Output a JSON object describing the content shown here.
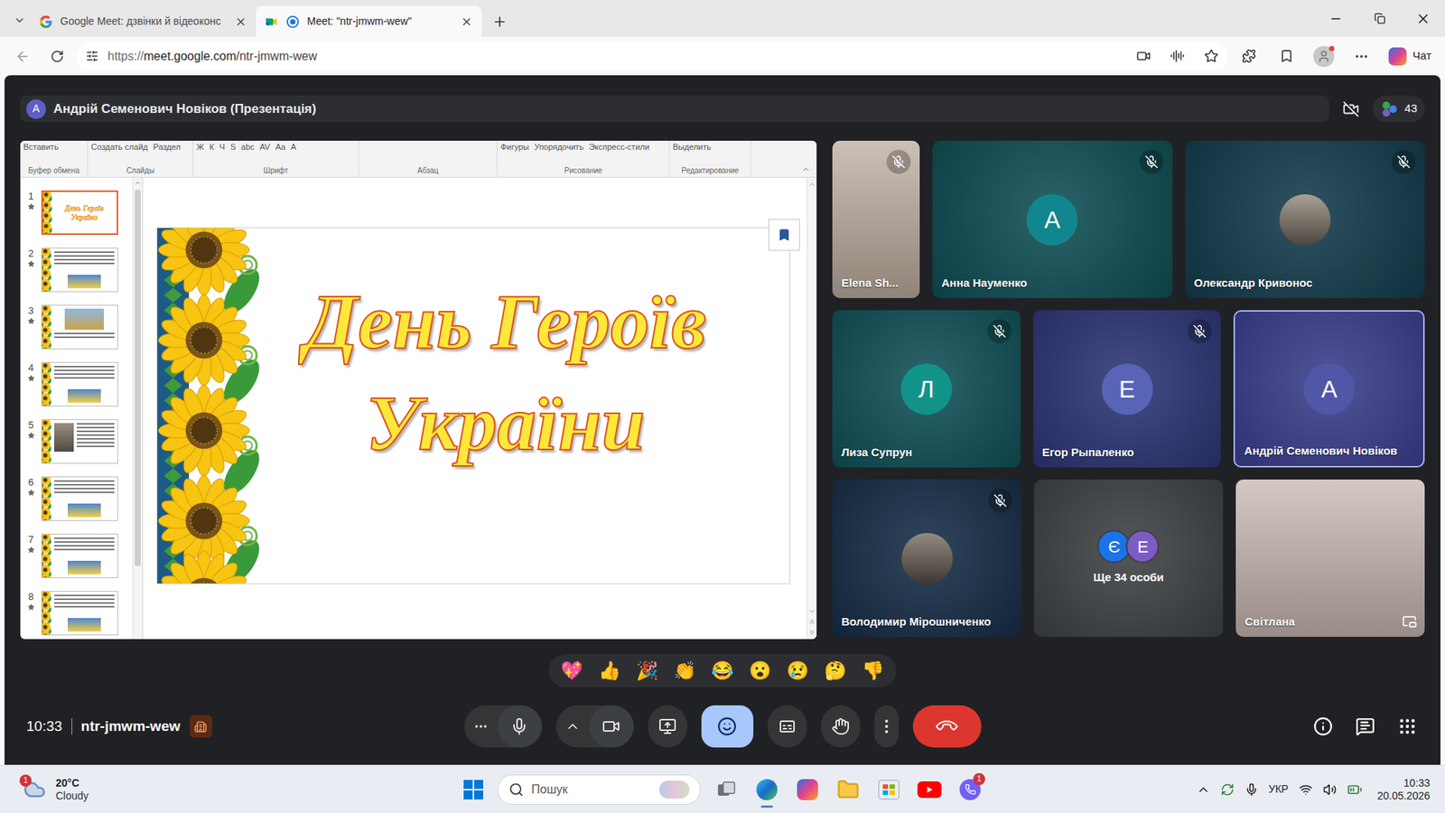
{
  "browser": {
    "tabs": [
      {
        "title": "Google Meet: дзвінки й відеоконс",
        "selected": false,
        "recording": false
      },
      {
        "title": "Meet: \"ntr-jmwm-wew\"",
        "selected": true,
        "recording": true
      }
    ],
    "url": {
      "scheme": "https://",
      "host": "meet.google.com",
      "path": "/ntr-jmwm-wew"
    },
    "copilot_label": "Чат"
  },
  "meet": {
    "presenter": {
      "initial": "А",
      "label": "Андрій Семенович Новіков (Презентація)"
    },
    "participant_count": "43",
    "presentation": {
      "ribbon": [
        {
          "label": "Буфер обмена",
          "items": [
            "Вставить"
          ]
        },
        {
          "label": "Слайды",
          "items": [
            "Создать слайд",
            "Раздел"
          ]
        },
        {
          "label": "Шрифт",
          "items": [
            "Ж",
            "К",
            "Ч",
            "S",
            "abc",
            "AV",
            "Aa",
            "A"
          ]
        },
        {
          "label": "Абзац",
          "items": []
        },
        {
          "label": "Рисование",
          "items": [
            "Фигуры",
            "Упорядочить",
            "Экспресс-стили"
          ]
        },
        {
          "label": "Редактирование",
          "items": [
            "Выделить"
          ]
        }
      ],
      "thumbnails": [
        {
          "number": "1",
          "selected": true,
          "kind": "title"
        },
        {
          "number": "2",
          "selected": false,
          "kind": "text-picture"
        },
        {
          "number": "3",
          "selected": false,
          "kind": "picture-text"
        },
        {
          "number": "4",
          "selected": false,
          "kind": "text-picture"
        },
        {
          "number": "5",
          "selected": false,
          "kind": "side"
        },
        {
          "number": "6",
          "selected": false,
          "kind": "text-picture"
        },
        {
          "number": "7",
          "selected": false,
          "kind": "text-picture"
        },
        {
          "number": "8",
          "selected": false,
          "kind": "text-picture"
        }
      ],
      "slide": {
        "title_lines": [
          "День Героїв",
          "України"
        ]
      }
    },
    "tiles": [
      [
        {
          "name": "Elena Sh...",
          "kind": "photo",
          "muted": true,
          "highlighted": false,
          "pip": false,
          "color": "#b9a89a"
        },
        {
          "name": "Анна Науменко",
          "kind": "avatar",
          "initial": "А",
          "muted": true,
          "highlighted": false,
          "pip": false,
          "color": "#0d4d53",
          "avatar_color": "#12868e"
        },
        {
          "name": "Олександр Кривонос",
          "kind": "photo-avatar",
          "muted": true,
          "highlighted": false,
          "pip": false,
          "color": "#123a4a",
          "avatar_color": "#8c8072"
        }
      ],
      [
        {
          "name": "Лиза Супрун",
          "kind": "avatar",
          "initial": "Л",
          "muted": true,
          "highlighted": false,
          "pip": false,
          "color": "#0e4f55",
          "avatar_color": "#12938a"
        },
        {
          "name": "Егор Рыпаленко",
          "kind": "avatar",
          "initial": "Е",
          "muted": true,
          "highlighted": false,
          "pip": false,
          "color": "#2a3474",
          "avatar_color": "#5865b6"
        },
        {
          "name": "Андрій Семенович Новіков",
          "kind": "avatar",
          "initial": "А",
          "muted": false,
          "highlighted": true,
          "pip": false,
          "color": "#383d8a",
          "avatar_color": "#5156a6"
        }
      ],
      [
        {
          "name": "Володимир Мірошниченко",
          "kind": "photo-avatar",
          "muted": true,
          "highlighted": false,
          "pip": false,
          "color": "#152b45",
          "avatar_color": "#6f6558"
        },
        {
          "name": "Ще 34 особи",
          "kind": "more",
          "muted": false,
          "highlighted": false,
          "pip": false,
          "color": "#3c4043",
          "initials": [
            {
              "letter": "Є",
              "color": "#1a73e8"
            },
            {
              "letter": "Е",
              "color": "#7b5cc4"
            }
          ]
        },
        {
          "name": "Світлана",
          "kind": "photo",
          "muted": false,
          "highlighted": false,
          "pip": true,
          "color": "#c4b3ad"
        }
      ]
    ],
    "reactions": [
      "💖",
      "👍",
      "🎉",
      "👏",
      "😂",
      "😮",
      "😢",
      "🤔",
      "👎"
    ],
    "clock": "10:33",
    "meeting_code": "ntr-jmwm-wew",
    "controls": [
      {
        "items": [
          {
            "kind": "more-horizontal",
            "selected": false
          },
          {
            "kind": "microphone",
            "selected": false
          }
        ]
      },
      {
        "items": [
          {
            "kind": "chevron-up",
            "selected": false
          },
          {
            "kind": "camera",
            "selected": false
          }
        ]
      },
      {
        "items": [
          {
            "kind": "present",
            "selected": false
          }
        ]
      },
      {
        "items": [
          {
            "kind": "reactions",
            "selected": true
          }
        ]
      },
      {
        "items": [
          {
            "kind": "captions",
            "selected": false
          }
        ]
      },
      {
        "items": [
          {
            "kind": "raise-hand",
            "selected": false
          }
        ]
      },
      {
        "items": [
          {
            "kind": "more-vertical",
            "selected": false
          }
        ]
      },
      {
        "items": [
          {
            "kind": "end-call",
            "selected": false
          }
        ]
      }
    ]
  },
  "taskbar": {
    "weather": {
      "temperature": "20°C",
      "condition": "Cloudy",
      "badge": "1"
    },
    "search_placeholder": "Пошук",
    "apps": [
      {
        "kind": "task-view",
        "active": false
      },
      {
        "kind": "edge",
        "active": true
      },
      {
        "kind": "copilot",
        "active": false
      },
      {
        "kind": "explorer",
        "active": false
      },
      {
        "kind": "store",
        "active": false
      },
      {
        "kind": "youtube",
        "active": false
      },
      {
        "kind": "viber",
        "active": false,
        "badge": "1"
      }
    ],
    "language": "УКР",
    "time": "10:33",
    "date": "20.05.2026"
  }
}
